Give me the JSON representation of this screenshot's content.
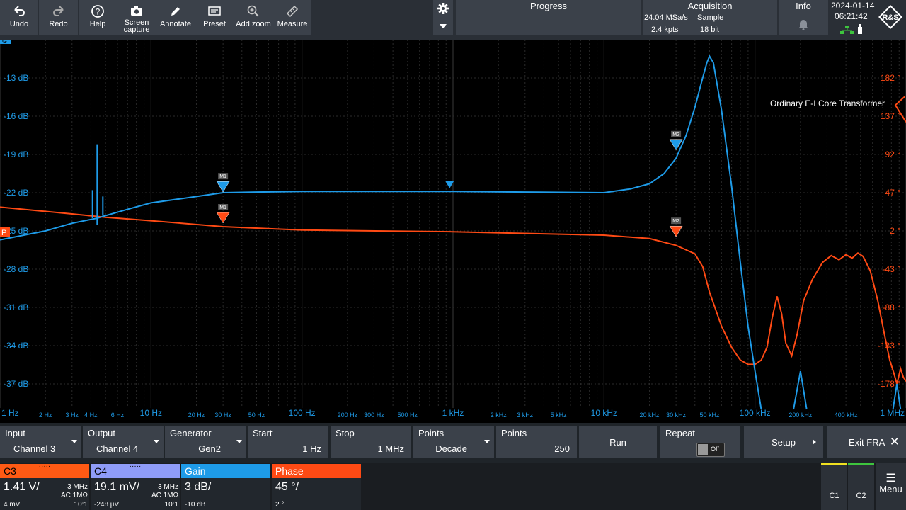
{
  "toolbar": {
    "undo": "Undo",
    "redo": "Redo",
    "help": "Help",
    "screen_capture_1": "Screen",
    "screen_capture_2": "capture",
    "annotate": "Annotate",
    "preset": "Preset",
    "add_zoom": "Add zoom",
    "measure": "Measure"
  },
  "header": {
    "progress": "Progress",
    "acquisition": "Acquisition",
    "sample_rate": "24.04 MSa/s",
    "sample_mode": "Sample",
    "record_length": "2.4 kpts",
    "resolution": "18 bit",
    "info": "Info",
    "date": "2024-01-14",
    "time": "06:21:42"
  },
  "plot": {
    "annotation": "Ordinary E-I Core Transformer",
    "gain_axis_label": "G",
    "phase_axis_label": "P",
    "gain_ticks": [
      "-13 dB",
      "-16 dB",
      "-19 dB",
      "-22 dB",
      "-25 dB",
      "-28 dB",
      "-31 dB",
      "-34 dB",
      "-37 dB"
    ],
    "phase_ticks": [
      "182 °",
      "137 °",
      "92 °",
      "47 °",
      "2 °",
      "-43 °",
      "-88 °",
      "-133 °",
      "-178 °"
    ],
    "freq_ticks_major": [
      "1 Hz",
      "10 Hz",
      "100 Hz",
      "1 kHz",
      "10 kHz",
      "100 kHz",
      "1 MHz"
    ],
    "freq_ticks_minor": [
      "2 Hz",
      "3 Hz",
      "4 Hz",
      "6 Hz",
      "20 Hz",
      "30 Hz",
      "50 Hz",
      "200 Hz",
      "300 Hz",
      "500 Hz",
      "2 kHz",
      "3 kHz",
      "5 kHz",
      "20 kHz",
      "30 kHz",
      "50 kHz",
      "200 kHz",
      "400 kHz"
    ],
    "marker_m1": "M1",
    "marker_m2": "M2",
    "colors": {
      "gain": "#1e9be8",
      "phase": "#ff4a14",
      "grid": "#3a3a3a"
    }
  },
  "fra": {
    "input_label": "Input",
    "input_value": "Channel 3",
    "output_label": "Output",
    "output_value": "Channel 4",
    "generator_label": "Generator",
    "generator_value": "Gen2",
    "start_label": "Start",
    "start_value": "1 Hz",
    "stop_label": "Stop",
    "stop_value": "1 MHz",
    "points_mode_label": "Points",
    "points_mode_value": "Decade",
    "points_label": "Points",
    "points_value": "250",
    "run": "Run",
    "repeat_label": "Repeat",
    "repeat_value": "Off",
    "setup": "Setup",
    "exit": "Exit FRA"
  },
  "tiles": {
    "c3": {
      "name": "C3",
      "value": "1.41 V/",
      "bw": "3 MHz",
      "coupling": "AC 1MΩ",
      "offset": "4 mV",
      "ratio": "10:1"
    },
    "c4": {
      "name": "C4",
      "value": "19.1 mV/",
      "bw": "3 MHz",
      "coupling": "AC 1MΩ",
      "offset": "-248 µV",
      "ratio": "10:1"
    },
    "gain": {
      "name": "Gain",
      "value": "3 dB/",
      "offset": "-10 dB"
    },
    "phase": {
      "name": "Phase",
      "value": "45 °/",
      "offset": "2 °"
    },
    "c1": "C1",
    "c2": "C2",
    "menu": "Menu"
  }
}
